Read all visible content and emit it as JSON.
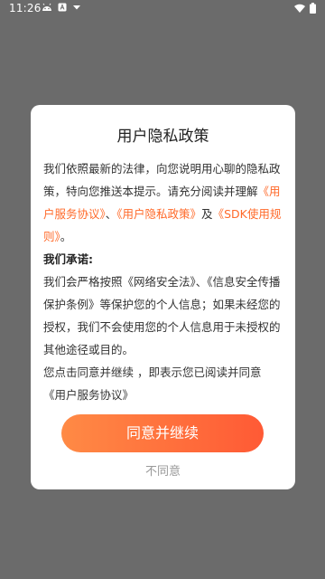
{
  "status_bar": {
    "time": "11:26",
    "left_icons": [
      "android-icon",
      "a-box-icon",
      "download-arrow-icon"
    ],
    "right_icons": [
      "wifi-icon",
      "battery-icon"
    ]
  },
  "dialog": {
    "title": "用户隐私政策",
    "intro_1": "我们依照最新的法律，向您说明用心聊的隐私政策，特向您推送本提示。请充分阅读并理解",
    "link_service": "《用户服务协议》",
    "sep_1": "、",
    "link_privacy": "《用户隐私政策》",
    "sep_2": "及",
    "link_sdk": "《SDK使用规则》",
    "intro_end": "。",
    "promise_heading": "我们承诺:",
    "promise_1": "我们会严格按照《网络安全法》、《信息安全传播保护条例》等保护您的个人信息；如果未经您的授权，我们不会使用您的个人信息用于未授权的其他途径或目的。",
    "consent_note": "您点击同意并继续 ，即表示您已阅读并同意《用户服务协议》",
    "agree_label": "同意并继续",
    "disagree_label": "不同意"
  }
}
